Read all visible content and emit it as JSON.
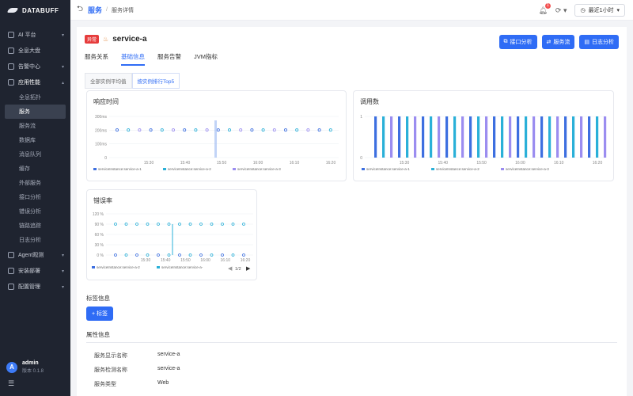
{
  "brand": {
    "name": "DATABUFF"
  },
  "sidebar": {
    "items": [
      {
        "label": "AI 平台",
        "chevron": "▾"
      },
      {
        "label": "全息大盘",
        "chevron": ""
      },
      {
        "label": "告警中心",
        "chevron": "▾"
      },
      {
        "label": "应用性能",
        "chevron": "▴"
      }
    ],
    "sub_items": [
      "全息拓扑",
      "服务",
      "服务流",
      "数据库",
      "消息队列",
      "缓存",
      "外部服务",
      "接口分析",
      "错误分析",
      "链路追踪",
      "日志分析"
    ],
    "bottom_items": [
      {
        "label": "Agent观测",
        "chevron": "▾"
      },
      {
        "label": "安装部署",
        "chevron": "▾"
      },
      {
        "label": "配置管理",
        "chevron": "▾"
      }
    ],
    "user": {
      "avatar": "A",
      "name": "admin",
      "version": "版本 0.1.8"
    }
  },
  "topbar": {
    "crumb_main": "服务",
    "crumb_detail": "服务详情",
    "notification_count": "1",
    "time_range": "最近1小时"
  },
  "service": {
    "status": "异常",
    "name": "service-a"
  },
  "actions": [
    "接口分析",
    "服务流",
    "日志分析"
  ],
  "tabs": [
    "服务关系",
    "基础信息",
    "服务告警",
    "JVM指标"
  ],
  "subtabs": [
    "全部实例平均值",
    "按实例排行Top5"
  ],
  "charts": {
    "response": {
      "title": "响应时间",
      "y_ticks": [
        "300ms",
        "200ms",
        "100ms",
        "0"
      ],
      "x_ticks": [
        "15:30",
        "15:40",
        "15:50",
        "16:00",
        "16:10",
        "16:20"
      ],
      "legend": [
        "serviceInstance:service-a-1",
        "serviceInstance:service-a-2",
        "serviceInstance:service-a-3"
      ]
    },
    "calls": {
      "title": "调用数",
      "y_ticks": [
        "1",
        "0"
      ],
      "x_ticks": [
        "15:30",
        "15:40",
        "15:50",
        "16:00",
        "16:10",
        "16:20"
      ],
      "legend": [
        "serviceInstance:service-a-1",
        "serviceInstance:service-a-2",
        "serviceInstance:service-a-3"
      ]
    },
    "error": {
      "title": "错误率",
      "y_ticks": [
        "120 %",
        "90 %",
        "60 %",
        "30 %",
        "0 %"
      ],
      "x_ticks": [
        "15:30",
        "15:40",
        "15:50",
        "16:00",
        "16:10",
        "16:20"
      ],
      "legend": [
        "serviceInstance:service-a-2",
        "serviceInstance:service-a-"
      ],
      "page": "1/2"
    }
  },
  "chart_data": [
    {
      "type": "scatter",
      "title": "响应时间",
      "ylabel": "",
      "ylim": [
        0,
        300
      ],
      "ticks_y": [
        "0",
        "100ms",
        "200ms",
        "300ms"
      ],
      "series_colors": [
        "#3d6fe0",
        "#2ab0d8",
        "#9b8df0"
      ]
    },
    {
      "type": "bar",
      "title": "调用数",
      "ylim": [
        0,
        1
      ],
      "series_colors": [
        "#3d6fe0",
        "#2ab0d8",
        "#9b8df0"
      ]
    },
    {
      "type": "scatter",
      "title": "错误率",
      "ylim": [
        0,
        120
      ],
      "series_colors": [
        "#3d6fe0",
        "#2ab0d8"
      ]
    }
  ],
  "tags": {
    "title": "标签信息",
    "add_label": "+ 标签"
  },
  "props": {
    "title": "属性信息",
    "rows": [
      {
        "k": "服务显示名称",
        "v": "service-a"
      },
      {
        "k": "服务检测名称",
        "v": "service-a"
      },
      {
        "k": "服务类型",
        "v": "Web"
      }
    ]
  }
}
